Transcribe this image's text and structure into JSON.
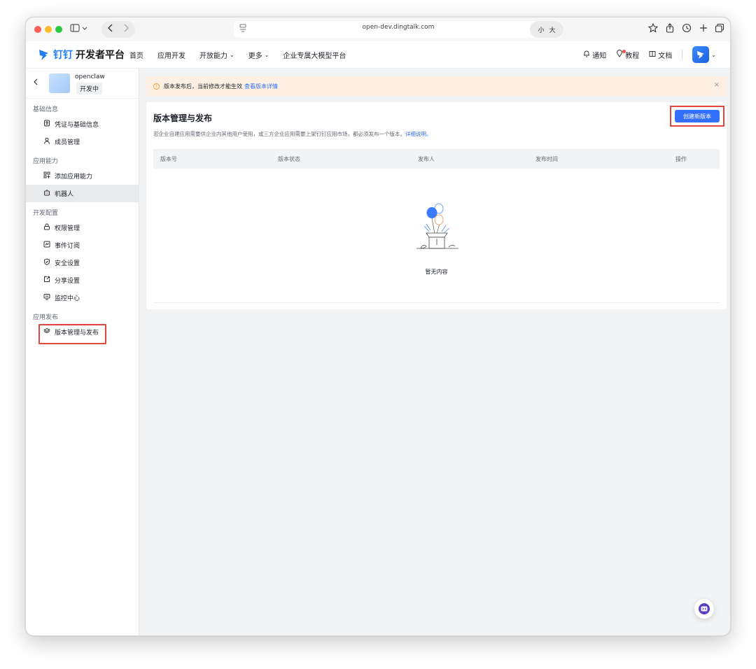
{
  "browser": {
    "url": "open-dev.dingtalk.com",
    "zoom_small": "小",
    "zoom_large": "大"
  },
  "header": {
    "brand": "钉钉",
    "platform": "开发者平台",
    "nav": [
      "首页",
      "应用开发",
      "开放能力",
      "更多",
      "企业专属大模型平台"
    ],
    "notice": "通知",
    "tutorial": "教程",
    "docs": "文档"
  },
  "sidebar": {
    "app_name": "openclaw",
    "app_status": "开发中",
    "groups": [
      {
        "title": "基础信息",
        "items": [
          "凭证与基础信息",
          "成员管理"
        ]
      },
      {
        "title": "应用能力",
        "items": [
          "添加应用能力",
          "机器人"
        ]
      },
      {
        "title": "开发配置",
        "items": [
          "权限管理",
          "事件订阅",
          "安全设置",
          "分享设置",
          "监控中心"
        ]
      },
      {
        "title": "应用发布",
        "items": [
          "版本管理与发布"
        ]
      }
    ]
  },
  "notice_bar": {
    "text": "版本发布后，当前修改才能生效",
    "link": "查看版本详情"
  },
  "main": {
    "title": "版本管理与发布",
    "description": "若企业自建应用需要供企业内其他用户使用，或三方企业应用需要上架钉钉应用市场，都必须发布一个版本。",
    "description_link": "详细说明。",
    "create_button": "创建新版本",
    "columns": [
      "版本号",
      "版本状态",
      "发布人",
      "发布时间",
      "操作"
    ],
    "empty_text": "暂无内容"
  },
  "colors": {
    "accent": "#3370ff",
    "highlight": "#e0483e",
    "notice_bg": "#fdf0e3"
  }
}
